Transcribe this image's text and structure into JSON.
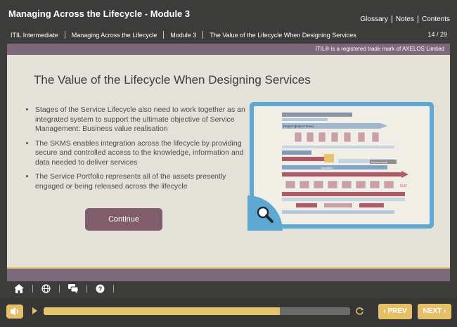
{
  "header": {
    "course_title": "Managing Across the Lifecycle - Module 3",
    "links": {
      "glossary": "Glossary",
      "notes": "Notes",
      "contents": "Contents"
    },
    "breadcrumbs": [
      "ITIL Intermediate",
      "Managing Across the Lifecycle",
      "Module 3",
      "The Value of the Lifecycle When Designing Services"
    ],
    "page_count": "14 / 29"
  },
  "trademark": "ITIL® is a registered trade mark of AXELOS Limited",
  "slide": {
    "title": "The Value of the Lifecycle When Designing Services",
    "bullets": [
      "Stages of the Service Lifecycle also need to work together as an integrated system to support the ultimate objective of Service Management: Business value realisation",
      "The SKMS enables integration across the lifecycle by providing secure and controlled access to the knowledge, information and data needed to deliver services",
      "The Service Portfolio represents all of the assets presently engaged or being released across the lifecycle"
    ],
    "continue_label": "Continue",
    "figure_labels": {
      "project": "Project (project team)",
      "operation": "Operation",
      "improvement": "Improvement",
      "slr": "SLR"
    }
  },
  "footer": {
    "progress_fraction": 0.77,
    "prev_label": "PREV",
    "next_label": "NEXT"
  },
  "colors": {
    "accent": "#e6bf69",
    "plum": "#7d677b",
    "button": "#7f5d6a",
    "frame": "#5fa8d3"
  },
  "icons": [
    "home-icon",
    "globe-icon",
    "chat-icon",
    "help-icon",
    "speaker-icon",
    "play-icon",
    "replay-icon",
    "zoom-icon"
  ]
}
